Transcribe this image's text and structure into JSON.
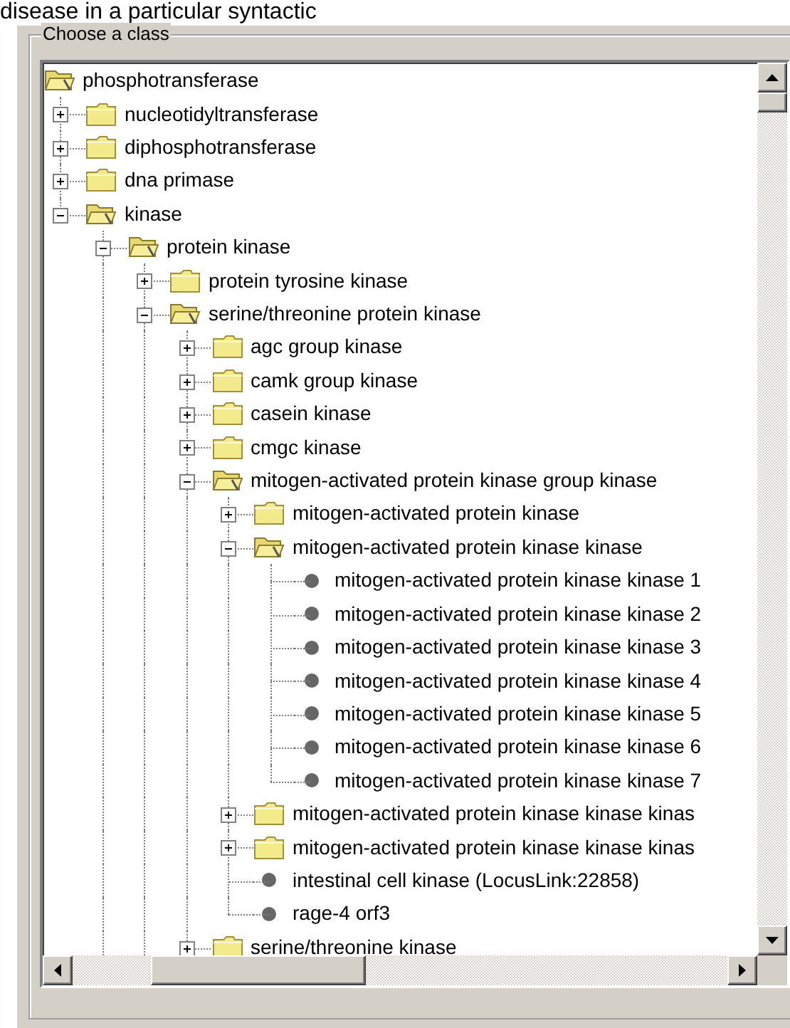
{
  "page_heading": "disease in a particular syntactic",
  "panel": {
    "legend": "Choose a class",
    "tree": {
      "label": "phosphotransferase",
      "kind": "folder",
      "expanded": true,
      "children": [
        {
          "label": "nucleotidyltransferase",
          "kind": "folder",
          "expanded": false
        },
        {
          "label": "diphosphotransferase",
          "kind": "folder",
          "expanded": false
        },
        {
          "label": "dna primase",
          "kind": "folder",
          "expanded": false
        },
        {
          "label": "kinase",
          "kind": "folder",
          "expanded": true,
          "more_below": true,
          "children": [
            {
              "label": "protein kinase",
              "kind": "folder",
              "expanded": true,
              "more_below": true,
              "children": [
                {
                  "label": "protein tyrosine kinase",
                  "kind": "folder",
                  "expanded": false
                },
                {
                  "label": "serine/threonine protein kinase",
                  "kind": "folder",
                  "expanded": true,
                  "more_below": true,
                  "children": [
                    {
                      "label": "agc group kinase",
                      "kind": "folder",
                      "expanded": false
                    },
                    {
                      "label": "camk group kinase",
                      "kind": "folder",
                      "expanded": false
                    },
                    {
                      "label": "casein kinase",
                      "kind": "folder",
                      "expanded": false
                    },
                    {
                      "label": "cmgc kinase",
                      "kind": "folder",
                      "expanded": false
                    },
                    {
                      "label": "mitogen-activated protein kinase group kinase",
                      "kind": "folder",
                      "expanded": true,
                      "children": [
                        {
                          "label": "mitogen-activated protein kinase",
                          "kind": "folder",
                          "expanded": false
                        },
                        {
                          "label": "mitogen-activated protein kinase kinase",
                          "kind": "folder",
                          "expanded": true,
                          "children": [
                            {
                              "label": "mitogen-activated protein kinase kinase 1",
                              "kind": "item"
                            },
                            {
                              "label": "mitogen-activated protein kinase kinase 2",
                              "kind": "item"
                            },
                            {
                              "label": "mitogen-activated protein kinase kinase 3",
                              "kind": "item"
                            },
                            {
                              "label": "mitogen-activated protein kinase kinase 4",
                              "kind": "item"
                            },
                            {
                              "label": "mitogen-activated protein kinase kinase 5",
                              "kind": "item"
                            },
                            {
                              "label": "mitogen-activated protein kinase kinase 6",
                              "kind": "item"
                            },
                            {
                              "label": "mitogen-activated protein kinase kinase 7",
                              "kind": "item"
                            }
                          ]
                        },
                        {
                          "label": "mitogen-activated protein kinase kinase kinas",
                          "kind": "folder",
                          "expanded": false
                        },
                        {
                          "label": "mitogen-activated protein kinase kinase kinas",
                          "kind": "folder",
                          "expanded": false
                        },
                        {
                          "label": "intestinal cell kinase (LocusLink:22858)",
                          "kind": "item"
                        },
                        {
                          "label": "rage-4 orf3",
                          "kind": "item"
                        }
                      ]
                    },
                    {
                      "label": "serine/threonine kinase",
                      "kind": "folder",
                      "expanded": false
                    }
                  ]
                }
              ]
            }
          ]
        }
      ]
    }
  }
}
